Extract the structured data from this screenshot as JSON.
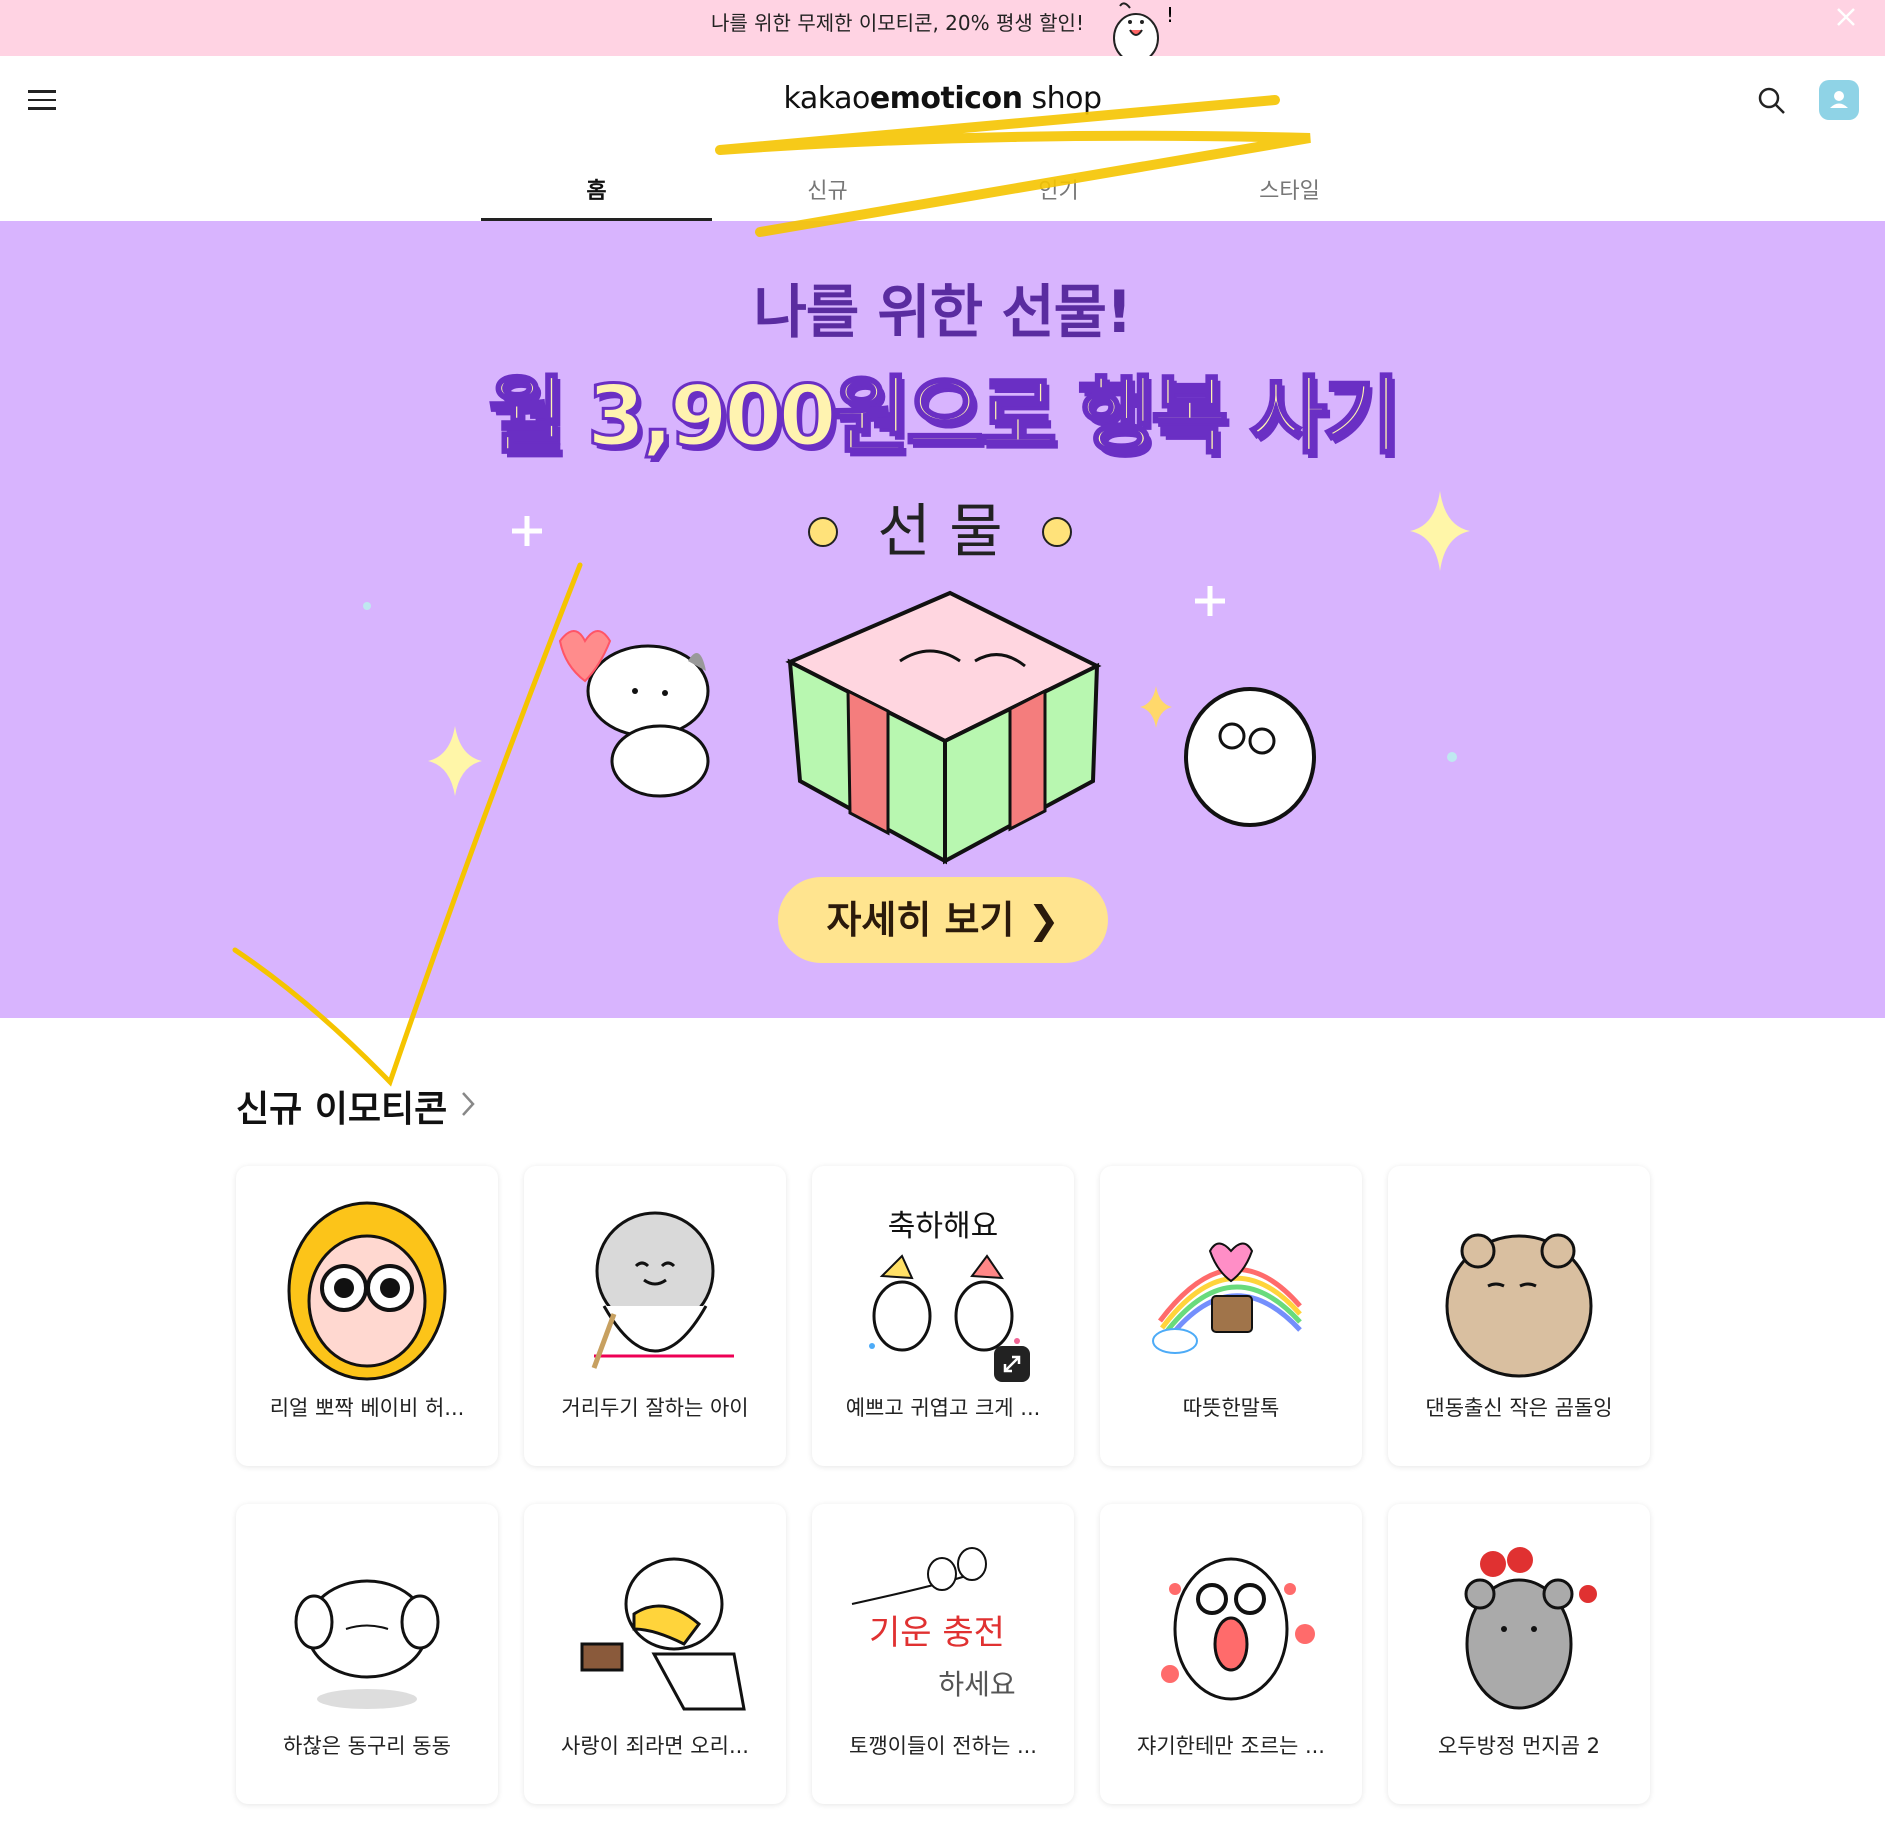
{
  "promo": {
    "text": "나를 위한 무제한 이모티콘, 20% 평생 할인!",
    "close_icon": "close-icon"
  },
  "header": {
    "logo_light": "kakao",
    "logo_bold": "emoticon",
    "logo_tail": " shop",
    "tabs": [
      {
        "label": "홈",
        "active": true
      },
      {
        "label": "신규",
        "active": false
      },
      {
        "label": "인기",
        "active": false
      },
      {
        "label": "스타일",
        "active": false
      }
    ]
  },
  "banner": {
    "title": "나를 위한 선물!",
    "subtitle": "월 3,900원으로 행복 사기",
    "art_text": "선 물",
    "cta": "자세히 보기 ❯",
    "background": "#d8b4fe"
  },
  "section": {
    "title": "신규 이모티콘",
    "items": [
      {
        "name": "리얼 뽀짝 베이비 허..."
      },
      {
        "name": "거리두기 잘하는 아이"
      },
      {
        "name": "예쁘고 귀엽고 크게 ...",
        "art_text": "축하해요"
      },
      {
        "name": "따뜻한말톡"
      },
      {
        "name": "댄동출신 작은 곰돌잉"
      },
      {
        "name": "하찮은 동구리 동동"
      },
      {
        "name": "사랑이 죄라면 오리..."
      },
      {
        "name": "토깽이들이 전하는 ...",
        "art_text_1": "기운 충전",
        "art_text_2": "하세요"
      },
      {
        "name": "쟈기한테만 조르는 ..."
      },
      {
        "name": "오두방정 먼지곰 2"
      }
    ]
  },
  "colors": {
    "promo_bg": "#ffd3e3",
    "accent": "#5a2ca0",
    "highlight_scribble": "#f5c400"
  }
}
